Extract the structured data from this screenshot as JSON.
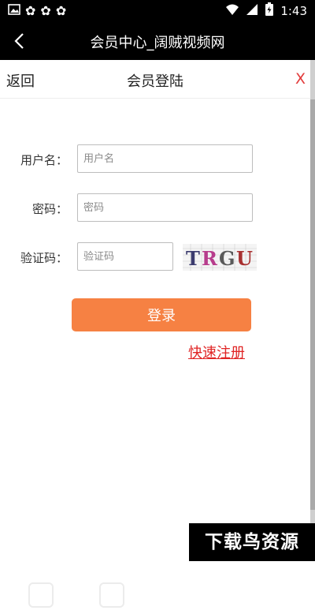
{
  "status_bar": {
    "time": "1:43",
    "notification_icons": [
      "image-icon",
      "bug-icon",
      "bug-icon",
      "bug-icon"
    ],
    "system_icons": [
      "wifi-icon",
      "signal-icon",
      "battery-charging-icon"
    ]
  },
  "app_bar": {
    "title": "会员中心_阔贼视频网",
    "back_icon": "arrow-left-icon"
  },
  "modal": {
    "back_label": "返回",
    "title": "会员登陆",
    "close_label": "X",
    "close_color": "#e23b3b"
  },
  "form": {
    "username": {
      "label": "用户名：",
      "placeholder": "用户名",
      "value": ""
    },
    "password": {
      "label": "密码：",
      "placeholder": "密码",
      "value": ""
    },
    "captcha": {
      "label": "验证码：",
      "placeholder": "验证码",
      "value": "",
      "image_text": "TRGU"
    },
    "login_label": "登录",
    "login_color": "#f68143",
    "register_label": "快速注册",
    "register_color": "#e02424"
  },
  "watermark": {
    "text": "下载鸟资源"
  }
}
